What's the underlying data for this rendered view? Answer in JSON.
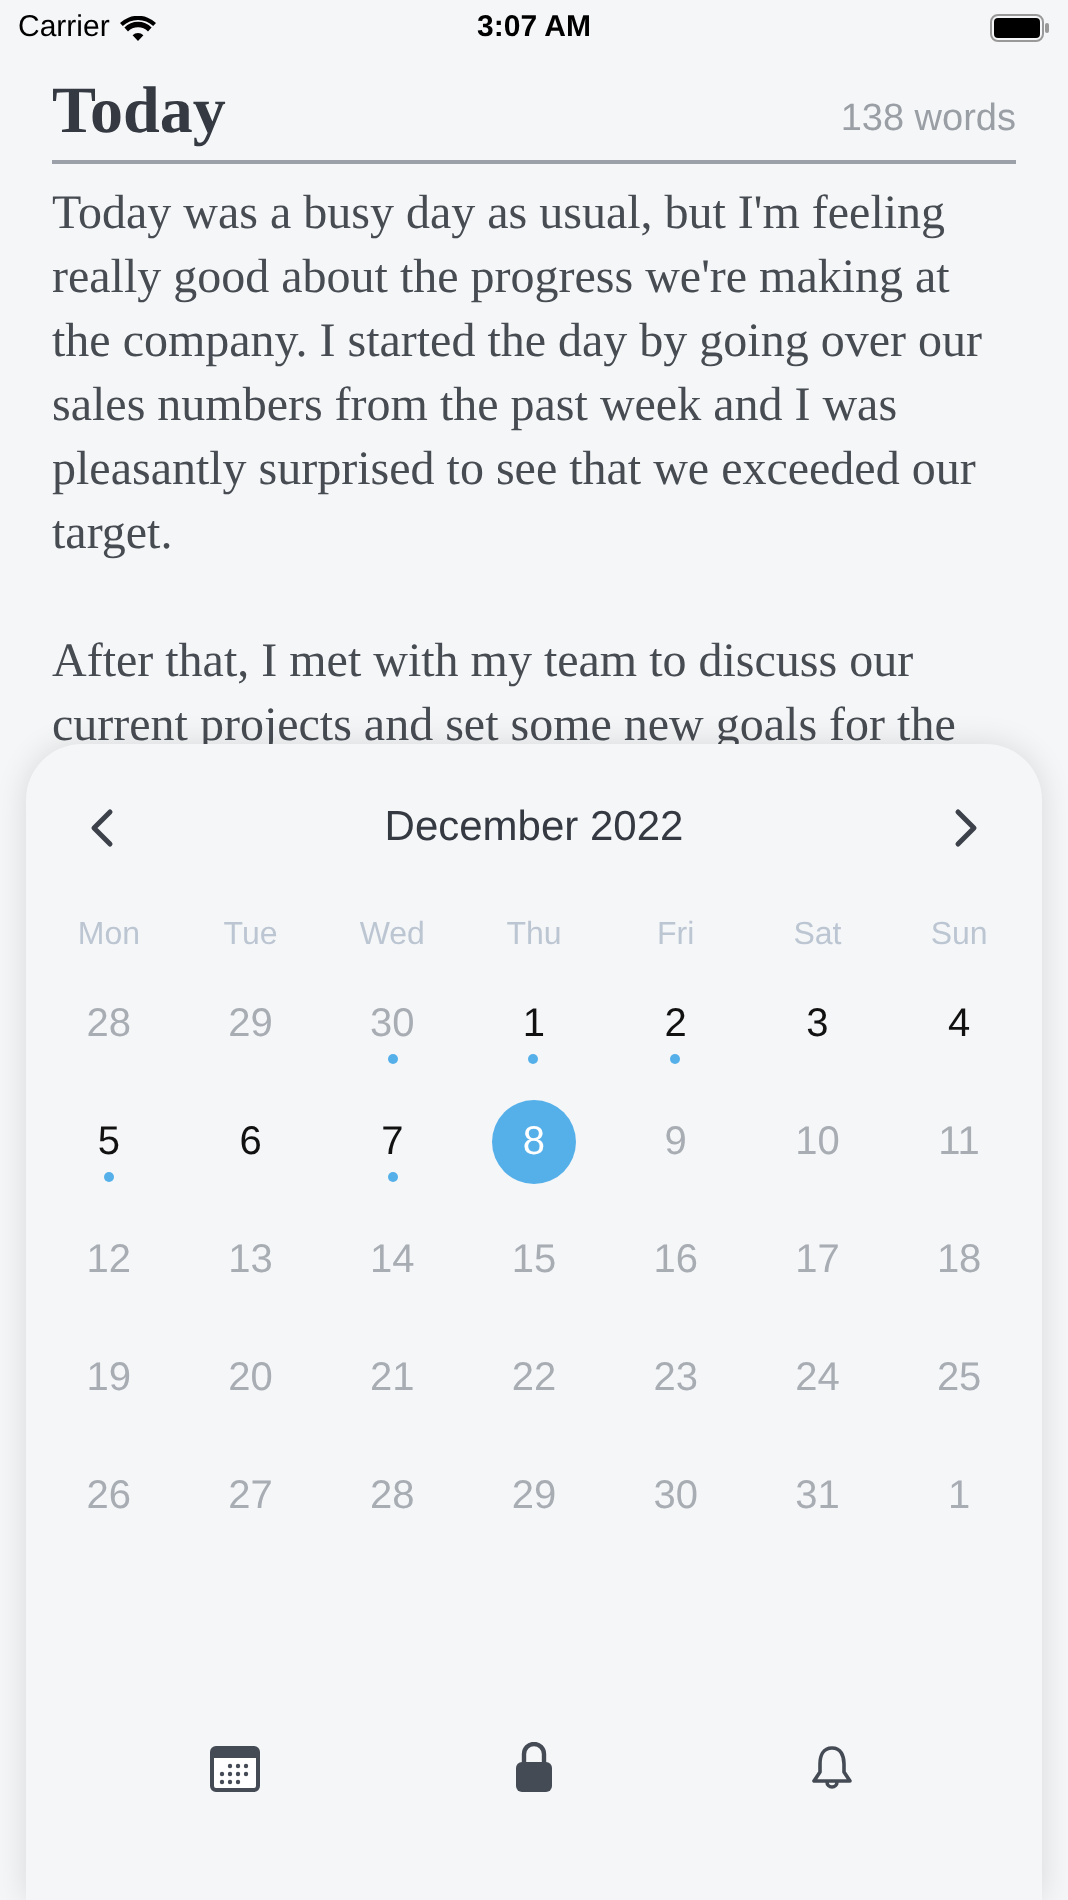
{
  "status_bar": {
    "carrier": "Carrier",
    "time": "3:07 AM"
  },
  "entry": {
    "title": "Today",
    "word_count": "138 words",
    "paragraphs": [
      "Today was a busy day as usual, but I'm feeling really good about the progress we're making at the company. I started the day by going over our sales numbers from the past week and I was pleasantly surprised to see that we exceeded our target.",
      "After that, I met with my team to discuss our current projects and set some new goals for the"
    ]
  },
  "calendar": {
    "month": "December 2022",
    "weekdays": [
      "Mon",
      "Tue",
      "Wed",
      "Thu",
      "Fri",
      "Sat",
      "Sun"
    ],
    "days": [
      {
        "label": "28",
        "in_month": false,
        "has_entry": false,
        "selected": false
      },
      {
        "label": "29",
        "in_month": false,
        "has_entry": false,
        "selected": false
      },
      {
        "label": "30",
        "in_month": false,
        "has_entry": true,
        "selected": false
      },
      {
        "label": "1",
        "in_month": true,
        "has_entry": true,
        "selected": false
      },
      {
        "label": "2",
        "in_month": true,
        "has_entry": true,
        "selected": false
      },
      {
        "label": "3",
        "in_month": true,
        "has_entry": false,
        "selected": false
      },
      {
        "label": "4",
        "in_month": true,
        "has_entry": false,
        "selected": false
      },
      {
        "label": "5",
        "in_month": true,
        "has_entry": true,
        "selected": false
      },
      {
        "label": "6",
        "in_month": true,
        "has_entry": false,
        "selected": false
      },
      {
        "label": "7",
        "in_month": true,
        "has_entry": true,
        "selected": false
      },
      {
        "label": "8",
        "in_month": true,
        "has_entry": false,
        "selected": true
      },
      {
        "label": "9",
        "in_month": false,
        "has_entry": false,
        "selected": false
      },
      {
        "label": "10",
        "in_month": false,
        "has_entry": false,
        "selected": false
      },
      {
        "label": "11",
        "in_month": false,
        "has_entry": false,
        "selected": false
      },
      {
        "label": "12",
        "in_month": false,
        "has_entry": false,
        "selected": false
      },
      {
        "label": "13",
        "in_month": false,
        "has_entry": false,
        "selected": false
      },
      {
        "label": "14",
        "in_month": false,
        "has_entry": false,
        "selected": false
      },
      {
        "label": "15",
        "in_month": false,
        "has_entry": false,
        "selected": false
      },
      {
        "label": "16",
        "in_month": false,
        "has_entry": false,
        "selected": false
      },
      {
        "label": "17",
        "in_month": false,
        "has_entry": false,
        "selected": false
      },
      {
        "label": "18",
        "in_month": false,
        "has_entry": false,
        "selected": false
      },
      {
        "label": "19",
        "in_month": false,
        "has_entry": false,
        "selected": false
      },
      {
        "label": "20",
        "in_month": false,
        "has_entry": false,
        "selected": false
      },
      {
        "label": "21",
        "in_month": false,
        "has_entry": false,
        "selected": false
      },
      {
        "label": "22",
        "in_month": false,
        "has_entry": false,
        "selected": false
      },
      {
        "label": "23",
        "in_month": false,
        "has_entry": false,
        "selected": false
      },
      {
        "label": "24",
        "in_month": false,
        "has_entry": false,
        "selected": false
      },
      {
        "label": "25",
        "in_month": false,
        "has_entry": false,
        "selected": false
      },
      {
        "label": "26",
        "in_month": false,
        "has_entry": false,
        "selected": false
      },
      {
        "label": "27",
        "in_month": false,
        "has_entry": false,
        "selected": false
      },
      {
        "label": "28",
        "in_month": false,
        "has_entry": false,
        "selected": false
      },
      {
        "label": "29",
        "in_month": false,
        "has_entry": false,
        "selected": false
      },
      {
        "label": "30",
        "in_month": false,
        "has_entry": false,
        "selected": false
      },
      {
        "label": "31",
        "in_month": false,
        "has_entry": false,
        "selected": false
      },
      {
        "label": "1",
        "in_month": false,
        "has_entry": false,
        "selected": false
      }
    ]
  },
  "tab_bar": [
    {
      "kind": "calendar"
    },
    {
      "kind": "lock"
    },
    {
      "kind": "bell"
    }
  ]
}
